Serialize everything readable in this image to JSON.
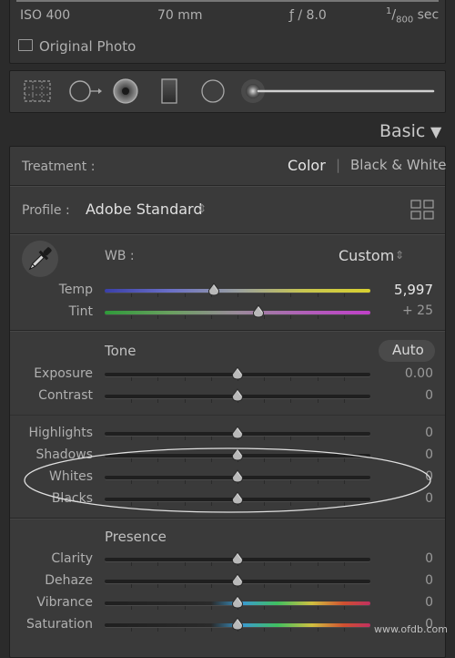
{
  "metadata": {
    "iso": "ISO 400",
    "focal": "70 mm",
    "aperture": "ƒ / 8.0",
    "shutter_num": "1",
    "shutter_den": "800",
    "shutter_unit": "sec",
    "original_photo": "Original Photo"
  },
  "panel": {
    "title": "Basic",
    "collapse_glyph": "▼"
  },
  "treatment": {
    "label": "Treatment :",
    "color": "Color",
    "bw": "Black & White",
    "sep": "|"
  },
  "profile": {
    "label": "Profile :",
    "value": "Adobe Standard",
    "arrows": "⇕"
  },
  "wb": {
    "label": "WB :",
    "value": "Custom",
    "arrows": "⇕"
  },
  "sliders": {
    "temp": {
      "label": "Temp",
      "value": "5,997",
      "pos": 0.41
    },
    "tint": {
      "label": "Tint",
      "value": "+ 25",
      "pos": 0.58
    },
    "exposure": {
      "label": "Exposure",
      "value": "0.00",
      "pos": 0.5
    },
    "contrast": {
      "label": "Contrast",
      "value": "0",
      "pos": 0.5
    },
    "highlights": {
      "label": "Highlights",
      "value": "0",
      "pos": 0.5
    },
    "shadows": {
      "label": "Shadows",
      "value": "0",
      "pos": 0.5
    },
    "whites": {
      "label": "Whites",
      "value": "0",
      "pos": 0.5
    },
    "blacks": {
      "label": "Blacks",
      "value": "0",
      "pos": 0.5
    },
    "clarity": {
      "label": "Clarity",
      "value": "0",
      "pos": 0.5
    },
    "dehaze": {
      "label": "Dehaze",
      "value": "0",
      "pos": 0.5
    },
    "vibrance": {
      "label": "Vibrance",
      "value": "0",
      "pos": 0.5
    },
    "saturation": {
      "label": "Saturation",
      "value": "0",
      "pos": 0.5
    }
  },
  "tone": {
    "label": "Tone",
    "auto": "Auto"
  },
  "presence": {
    "label": "Presence"
  },
  "watermark": "www.ofdb.com",
  "icons": [
    "crop-overlay-icon",
    "spot-removal-icon",
    "red-eye-icon",
    "graduated-filter-icon",
    "radial-filter-icon",
    "adjustment-brush-icon"
  ]
}
